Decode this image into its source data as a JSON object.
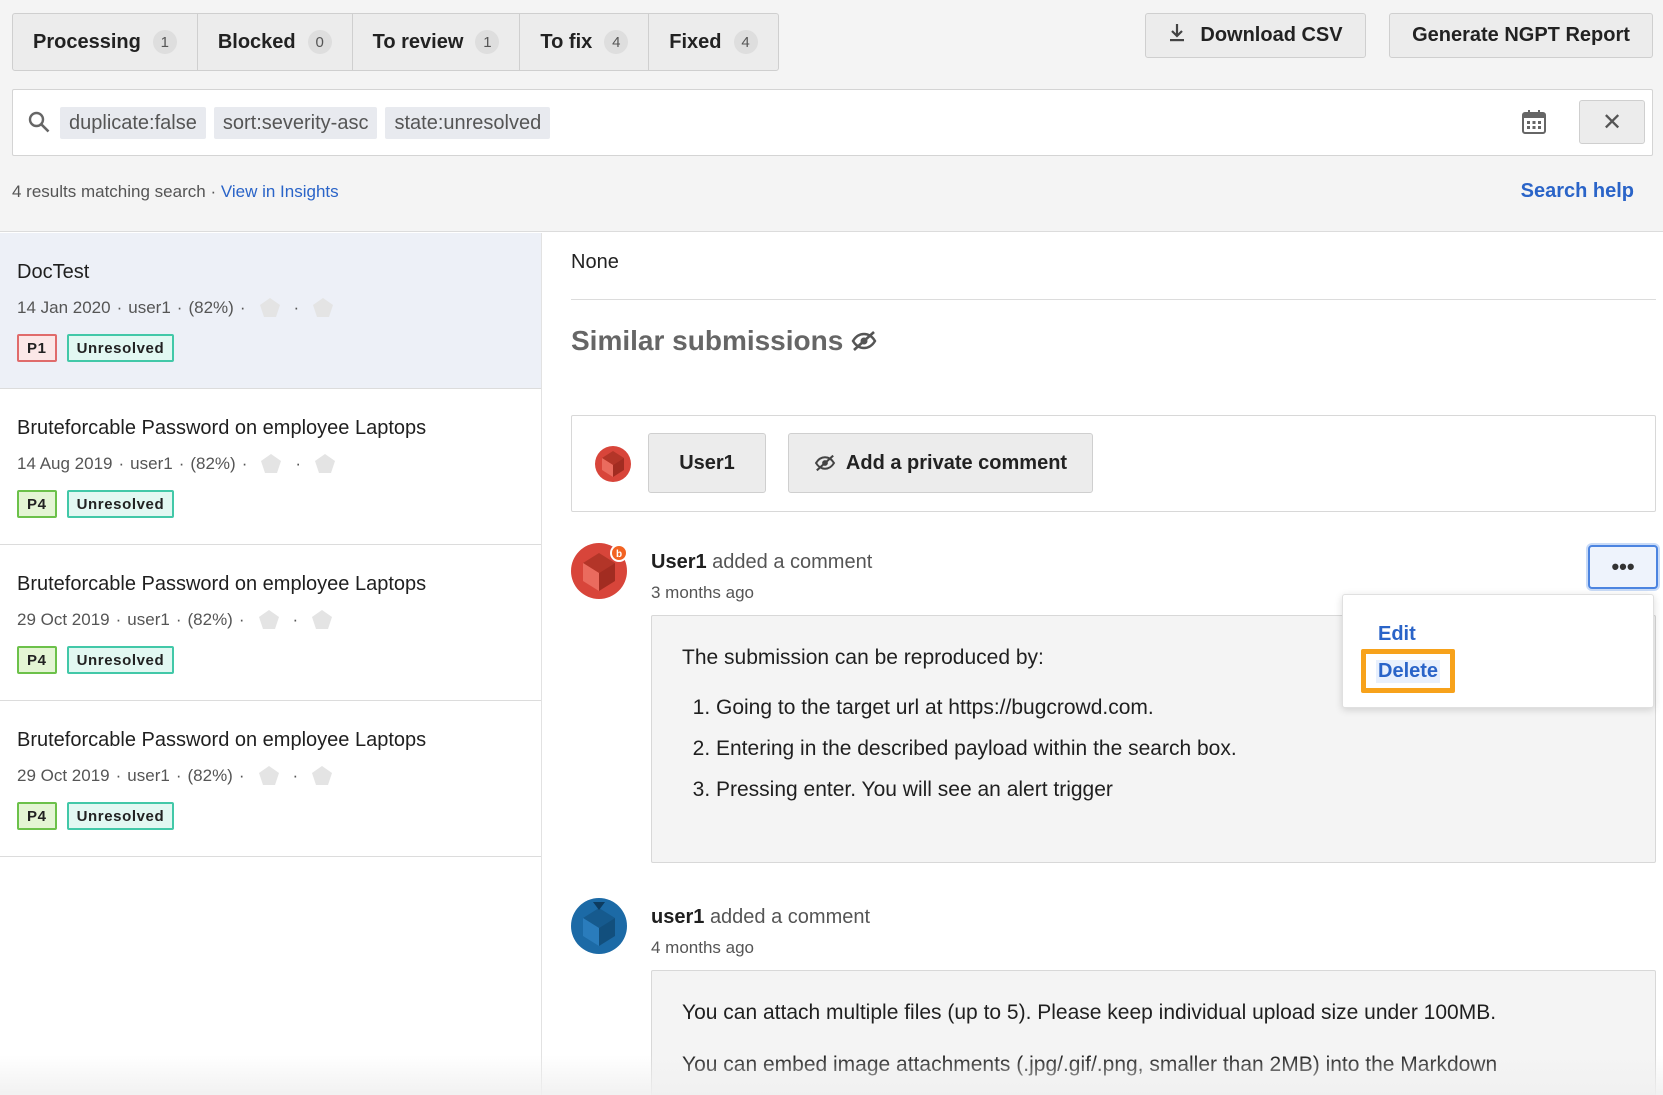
{
  "tabs": [
    {
      "label": "Processing",
      "count": "1"
    },
    {
      "label": "Blocked",
      "count": "0"
    },
    {
      "label": "To review",
      "count": "1"
    },
    {
      "label": "To fix",
      "count": "4"
    },
    {
      "label": "Fixed",
      "count": "4"
    }
  ],
  "actions": {
    "download_csv": "Download CSV",
    "generate_report": "Generate NGPT Report"
  },
  "search": {
    "chips": [
      "duplicate:false",
      "sort:severity-asc",
      "state:unresolved"
    ],
    "clear": "✕"
  },
  "results": {
    "text": "4 results matching search",
    "sep": "·",
    "insights_link": "View in Insights",
    "help": "Search help"
  },
  "submissions": [
    {
      "title": "DocTest",
      "date": "14 Jan 2020",
      "user": "user1",
      "pct": "(82%)",
      "priority": "P1",
      "state": "Unresolved"
    },
    {
      "title": "Bruteforcable Password on employee Laptops",
      "date": "14 Aug 2019",
      "user": "user1",
      "pct": "(82%)",
      "priority": "P4",
      "state": "Unresolved"
    },
    {
      "title": "Bruteforcable Password on employee Laptops",
      "date": "29 Oct 2019",
      "user": "user1",
      "pct": "(82%)",
      "priority": "P4",
      "state": "Unresolved"
    },
    {
      "title": "Bruteforcable Password on employee Laptops",
      "date": "29 Oct 2019",
      "user": "user1",
      "pct": "(82%)",
      "priority": "P4",
      "state": "Unresolved"
    }
  ],
  "detail": {
    "none": "None",
    "similar_heading": "Similar submissions",
    "composer": {
      "user_button": "User1",
      "private_button": "Add a private comment"
    },
    "comments": [
      {
        "author": "User1",
        "action": "added a comment",
        "time": "3 months ago",
        "intro": "The submission can be reproduced by:",
        "steps": [
          "Going to the target url at https://bugcrowd.com.",
          "Entering in the described payload within the search box.",
          "Pressing enter. You will see an alert trigger"
        ]
      },
      {
        "author": "user1",
        "action": "added a comment",
        "time": "4 months ago",
        "paragraphs": [
          "You can attach multiple files (up to 5). Please keep individual upload size under 100MB.",
          "You can embed image attachments (.jpg/.gif/.png, smaller than 2MB) into the Markdown"
        ]
      }
    ],
    "more_button": "•••",
    "menu": {
      "edit": "Edit",
      "delete": "Delete"
    }
  },
  "colors": {
    "link": "#2a64c8",
    "highlight": "#f7a21b",
    "p1": "#e06b6b",
    "p4": "#6cc14a",
    "unresolved": "#42c8a8"
  }
}
